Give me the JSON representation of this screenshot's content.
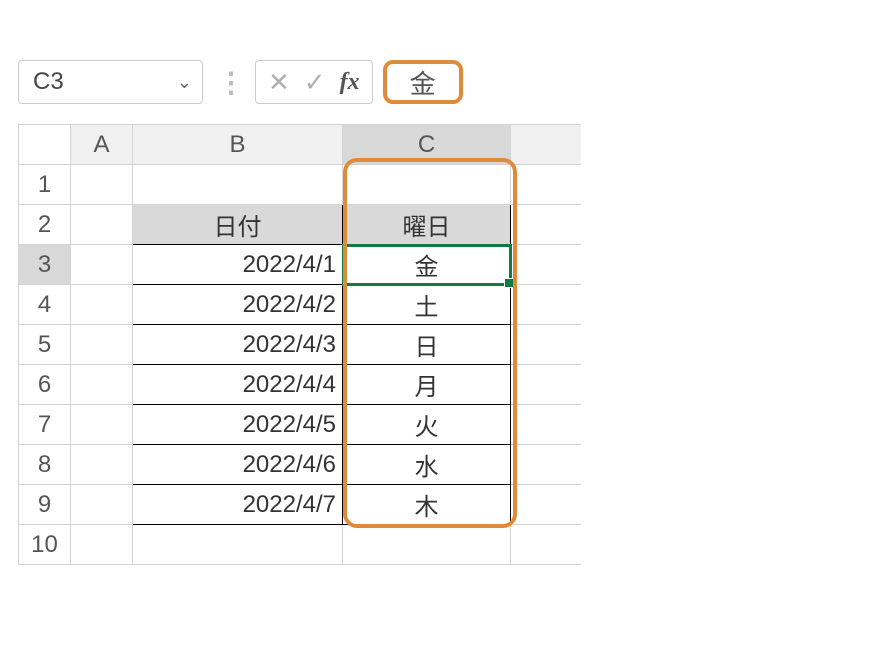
{
  "nameBox": {
    "value": "C3"
  },
  "formulaBar": {
    "value": "金"
  },
  "columns": {
    "A": "A",
    "B": "B",
    "C": "C"
  },
  "rowLabels": [
    "1",
    "2",
    "3",
    "4",
    "5",
    "6",
    "7",
    "8",
    "9",
    "10"
  ],
  "headers": {
    "date": "日付",
    "day": "曜日"
  },
  "rows": [
    {
      "date": "2022/4/1",
      "day": "金"
    },
    {
      "date": "2022/4/2",
      "day": "土"
    },
    {
      "date": "2022/4/3",
      "day": "日"
    },
    {
      "date": "2022/4/4",
      "day": "月"
    },
    {
      "date": "2022/4/5",
      "day": "火"
    },
    {
      "date": "2022/4/6",
      "day": "水"
    },
    {
      "date": "2022/4/7",
      "day": "木"
    }
  ]
}
